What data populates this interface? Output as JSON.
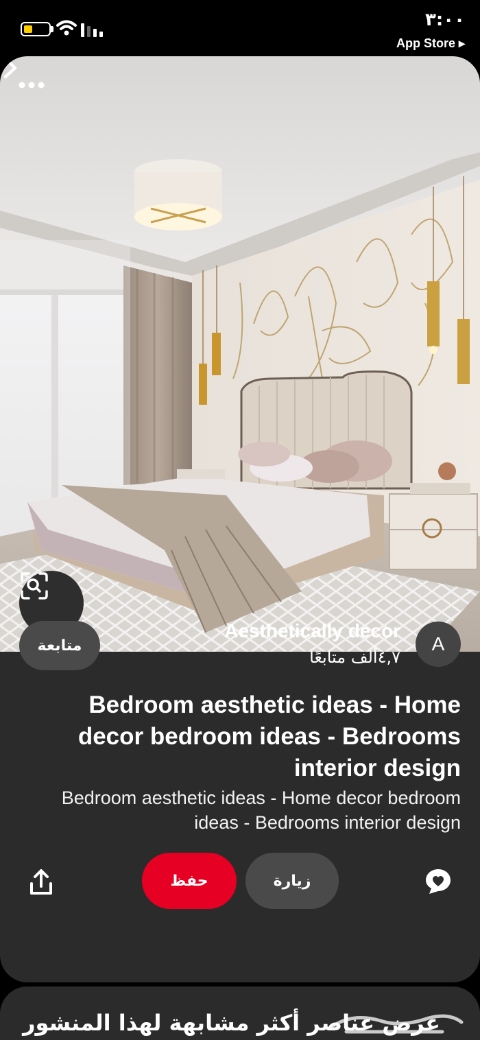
{
  "status_bar": {
    "time": "٣:٠٠",
    "back_app_label": "App Store ▸",
    "battery_level": 0.35,
    "battery_color": "#ffcc00"
  },
  "pin": {
    "image_alt": "Bedroom interior with upholstered bed, pendant lights and gold line-art wallpaper",
    "more_icon": "more-dots-icon",
    "next_icon": "chevron-right-icon",
    "lens_icon": "visual-search-icon"
  },
  "creator": {
    "avatar_initial": "A",
    "name": "Aesthetically decor",
    "followers": "٤,٧ألف متابعًا",
    "follow_label": "متابعة"
  },
  "content": {
    "title": "Bedroom aesthetic ideas - Home decor bedroom ideas - Bedrooms interior design",
    "description": "Bedroom aesthetic ideas - Home decor bedroom ideas - Bedrooms interior design"
  },
  "actions": {
    "save_label": "حفظ",
    "visit_label": "زيارة",
    "share_icon": "share-icon",
    "comment_icon": "comment-icon",
    "save_color": "#e60023"
  },
  "more_like_this": {
    "title": "عرض عناصر أكثر مشابهة لهذا المنشور"
  },
  "watermark": {
    "text": "حراج"
  }
}
